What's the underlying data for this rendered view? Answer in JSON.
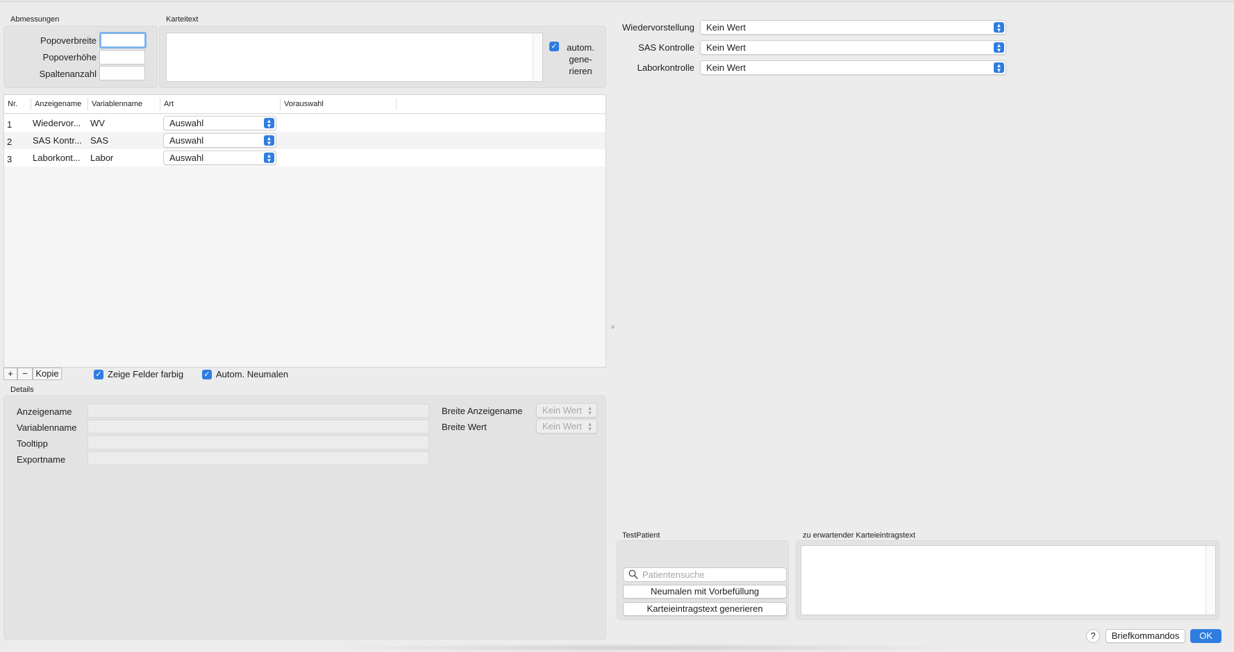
{
  "dimensions": {
    "section_label": "Abmessungen",
    "popover_width_label": "Popoverbreite",
    "popover_width_value": "",
    "popover_height_label": "Popoverhöhe",
    "popover_height_value": "",
    "column_count_label": "Spaltenanzahl",
    "column_count_value": ""
  },
  "card_text": {
    "section_label": "Karteitext",
    "value": "",
    "auto_generate_label_1": "autom.",
    "auto_generate_label_2": "gene-",
    "auto_generate_label_3": "rieren",
    "auto_generate_checked": true
  },
  "preview_fields": [
    {
      "label": "Wiedervorstellung",
      "value": "Kein Wert"
    },
    {
      "label": "SAS Kontrolle",
      "value": "Kein Wert"
    },
    {
      "label": "Laborkontrolle",
      "value": "Kein Wert"
    }
  ],
  "table": {
    "columns": [
      "Nr.",
      "Anzeigename",
      "Variablenname",
      "Art",
      "Vorauswahl"
    ],
    "rows": [
      {
        "nr": "1",
        "display_name": "Wiedervor...",
        "variable_name": "WV",
        "type": "Auswahl",
        "preselection": ""
      },
      {
        "nr": "2",
        "display_name": "SAS Kontr...",
        "variable_name": "SAS",
        "type": "Auswahl",
        "preselection": ""
      },
      {
        "nr": "3",
        "display_name": "Laborkont...",
        "variable_name": "Labor",
        "type": "Auswahl",
        "preselection": ""
      }
    ]
  },
  "table_toolbar": {
    "add_label": "+",
    "remove_label": "−",
    "copy_label": "Kopie",
    "show_colored_label": "Zeige Felder farbig",
    "show_colored_checked": true,
    "auto_redraw_label": "Autom. Neumalen",
    "auto_redraw_checked": true
  },
  "details": {
    "section_label": "Details",
    "display_name_label": "Anzeigename",
    "variable_name_label": "Variablenname",
    "tooltip_label": "Tooltipp",
    "export_name_label": "Exportname",
    "display_width_label": "Breite Anzeigename",
    "display_width_value": "Kein Wert",
    "value_width_label": "Breite Wert",
    "value_width_value": "Kein Wert"
  },
  "test_patient": {
    "section_label": "TestPatient",
    "search_placeholder": "Patientensuche",
    "redraw_prefill_label": "Neumalen mit Vorbefüllung",
    "generate_entry_label": "Karteieintragstext generieren"
  },
  "expected_entry": {
    "section_label": "zu erwartender Karteieintragstext",
    "value": ""
  },
  "footer": {
    "help_label": "?",
    "letter_commands_label": "Briefkommandos",
    "ok_label": "OK"
  },
  "colors": {
    "accent": "#2f7de1",
    "background": "#ececec"
  }
}
